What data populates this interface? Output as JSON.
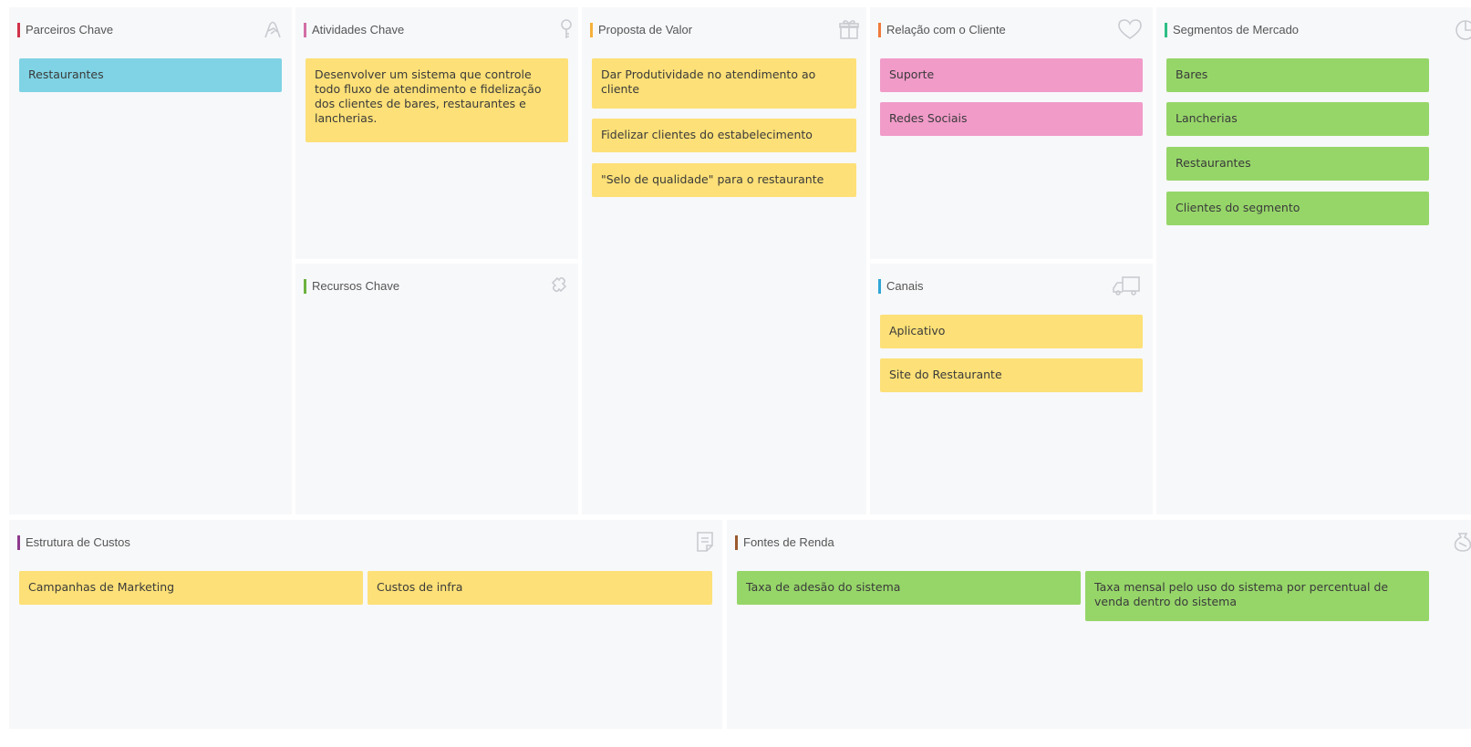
{
  "colors": {
    "yellow": "#fde077",
    "blue": "#7fd3e4",
    "pink": "#f19bc9",
    "green": "#96d669"
  },
  "panels": {
    "parceiros": {
      "title": "Parceiros Chave",
      "icon": "handshake-icon",
      "accent": "#d0334a",
      "cards": [
        "Restaurantes"
      ]
    },
    "atividades": {
      "title": "Atividades Chave",
      "icon": "key-icon",
      "accent": "#d26fa6",
      "cards": [
        "Desenvolver um sistema que controle todo fluxo de atendimento e fidelização dos clientes de bares, restaurantes e lancherias."
      ]
    },
    "recursos": {
      "title": "Recursos Chave",
      "icon": "puzzle-icon",
      "accent": "#6cb33f",
      "cards": []
    },
    "proposta": {
      "title": "Proposta de Valor",
      "icon": "gift-icon",
      "accent": "#f6b13a",
      "cards": [
        "Dar Produtividade no atendimento ao cliente",
        "Fidelizar clientes do estabelecimento",
        "\"Selo de qualidade\" para o restaurante"
      ]
    },
    "relacao": {
      "title": "Relação com o Cliente",
      "icon": "heart-icon",
      "accent": "#ef7a3a",
      "cards": [
        "Suporte",
        "Redes Sociais"
      ]
    },
    "canais": {
      "title": "Canais",
      "icon": "truck-icon",
      "accent": "#2fa6d6",
      "cards": [
        "Aplicativo",
        "Site do Restaurante"
      ]
    },
    "segmentos": {
      "title": "Segmentos de Mercado",
      "icon": "pie-chart-icon",
      "accent": "#2bbf86",
      "cards": [
        "Bares",
        "Lancherias",
        "Restaurantes",
        "Clientes do segmento"
      ]
    },
    "custos": {
      "title": "Estrutura de Custos",
      "icon": "document-icon",
      "accent": "#8e3a8e",
      "cards": [
        "Campanhas de Marketing",
        "Custos de infra"
      ]
    },
    "fontes": {
      "title": "Fontes de Renda",
      "icon": "money-bag-icon",
      "accent": "#9a5a2e",
      "cards": [
        "Taxa de adesão do sistema",
        "Taxa mensal pelo uso do sistema por percentual de venda dentro do sistema"
      ]
    }
  }
}
